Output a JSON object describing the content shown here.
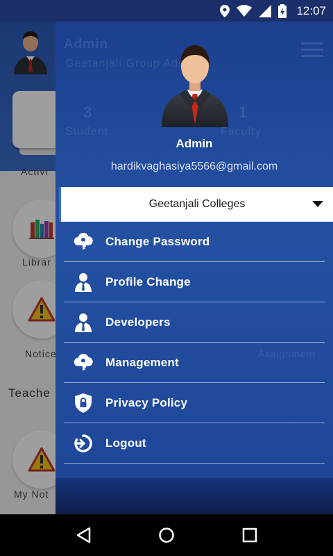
{
  "status_bar": {
    "time": "12:07",
    "icons": [
      "location-icon",
      "wifi-icon",
      "signal-icon",
      "battery-charging-icon"
    ]
  },
  "background_app": {
    "header_title": "Admin",
    "header_subtitle": "Geetanjali Group Admin",
    "stat_1_value": "3",
    "stat_1_label": "Student",
    "stat_2_value": "1",
    "stat_2_label": "Faculty",
    "activity_label": "Activi",
    "library_label": "Librar",
    "notice_label": "Notice",
    "section_title": "Teache",
    "my_notice_label": "My Not",
    "assignment_label": "Assignment"
  },
  "drawer": {
    "profile": {
      "name": "Admin",
      "email": "hardikvaghasiya5566@gmail.com"
    },
    "college_select": {
      "selected": "Geetanjali Colleges"
    },
    "menu": [
      {
        "label": "Change Password",
        "icon": "cloud-key-icon"
      },
      {
        "label": "Profile Change",
        "icon": "person-icon"
      },
      {
        "label": "Developers",
        "icon": "developer-icon"
      },
      {
        "label": "Management",
        "icon": "cloud-gear-icon"
      },
      {
        "label": "Privacy Policy",
        "icon": "shield-lock-icon"
      },
      {
        "label": "Logout",
        "icon": "logout-icon"
      }
    ]
  },
  "nav_bar": {
    "icons": [
      "back-icon",
      "home-icon",
      "recents-icon"
    ]
  },
  "colors": {
    "drawer_top": "#1c3f8e",
    "drawer_bottom": "#1d4597",
    "status_bar": "#1b2f6b",
    "accent": "#3d6fcc"
  }
}
